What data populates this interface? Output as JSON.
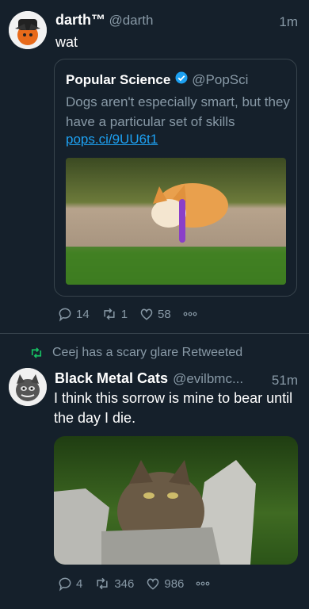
{
  "tweet1": {
    "name": "darth™",
    "handle": "@darth",
    "time": "1m",
    "text": "wat",
    "quote": {
      "name": "Popular Science",
      "handle": "@PopSci",
      "text": "Dogs aren't especially smart, but they have a particular set of skills",
      "link": "pops.ci/9UU6t1"
    },
    "actions": {
      "replies": "14",
      "retweets": "1",
      "likes": "58"
    }
  },
  "retweet_header": {
    "text": "Ceej has a scary glare Retweeted"
  },
  "tweet2": {
    "name": "Black Metal Cats",
    "handle": "@evilbmc...",
    "time": "51m",
    "text": "I think this sorrow is mine to bear until the day I die.",
    "actions": {
      "replies": "4",
      "retweets": "346",
      "likes": "986"
    }
  },
  "colors": {
    "background": "#15202b",
    "accent": "#1da1f2",
    "retweet_green": "#17bf63",
    "muted": "#8899a6"
  }
}
